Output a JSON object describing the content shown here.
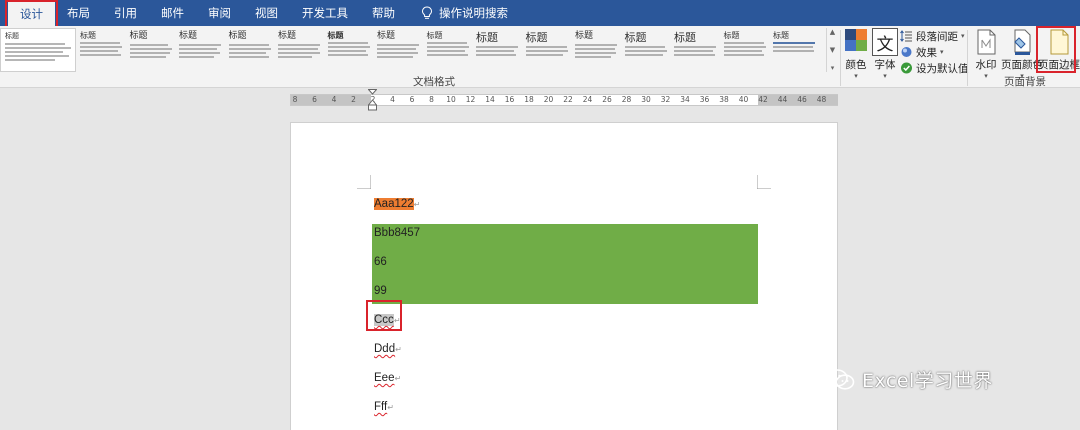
{
  "tabs": [
    {
      "label": "设计"
    },
    {
      "label": "布局"
    },
    {
      "label": "引用"
    },
    {
      "label": "邮件"
    },
    {
      "label": "审阅"
    },
    {
      "label": "视图"
    },
    {
      "label": "开发工具"
    },
    {
      "label": "帮助"
    }
  ],
  "tell_me": "操作说明搜索",
  "gallery": {
    "items": [
      {
        "title": "标题"
      },
      {
        "title": "标题"
      },
      {
        "title": "标题"
      },
      {
        "title": "标题"
      },
      {
        "title": "标题"
      },
      {
        "title": "标题"
      },
      {
        "title": "标题"
      },
      {
        "title": "标题"
      },
      {
        "title": "标题"
      },
      {
        "title": "标题"
      },
      {
        "title": "标题"
      },
      {
        "title": "标题"
      },
      {
        "title": "标题"
      },
      {
        "title": "标题"
      },
      {
        "title": "标题"
      },
      {
        "title": "标题"
      }
    ],
    "group_label": "文档格式"
  },
  "design_buttons": {
    "colors": "颜色",
    "fonts": "字体",
    "fonts_glyph": "文",
    "paragraph_spacing": "段落间距",
    "effects": "效果",
    "set_default": "设为默认值"
  },
  "page_background": {
    "watermark": "水印",
    "page_color": "页面颜色",
    "page_borders": "页面边框",
    "group_label": "页面背景"
  },
  "ruler": {
    "numbers": [
      "8",
      "6",
      "4",
      "2",
      "2",
      "4",
      "6",
      "8",
      "10",
      "12",
      "14",
      "16",
      "18",
      "20",
      "22",
      "24",
      "26",
      "28",
      "30",
      "32",
      "34",
      "36",
      "38",
      "40",
      "42",
      "44",
      "46",
      "48"
    ]
  },
  "document": {
    "paragraphs": [
      {
        "text": "Aaa122"
      },
      {
        "text": "Bbb8457"
      },
      {
        "text": "66"
      },
      {
        "text": "99"
      },
      {
        "text": "Ccc"
      },
      {
        "text": "Ddd"
      },
      {
        "text": "Eee"
      },
      {
        "text": "Fff"
      }
    ],
    "paragraph_mark": "↵"
  },
  "watermark": {
    "text": "Excel学习世界"
  },
  "colors": {
    "accent": "#2b579a",
    "highlight_red": "#d9232b",
    "orange": "#ee7d31",
    "green": "#70ad47"
  }
}
